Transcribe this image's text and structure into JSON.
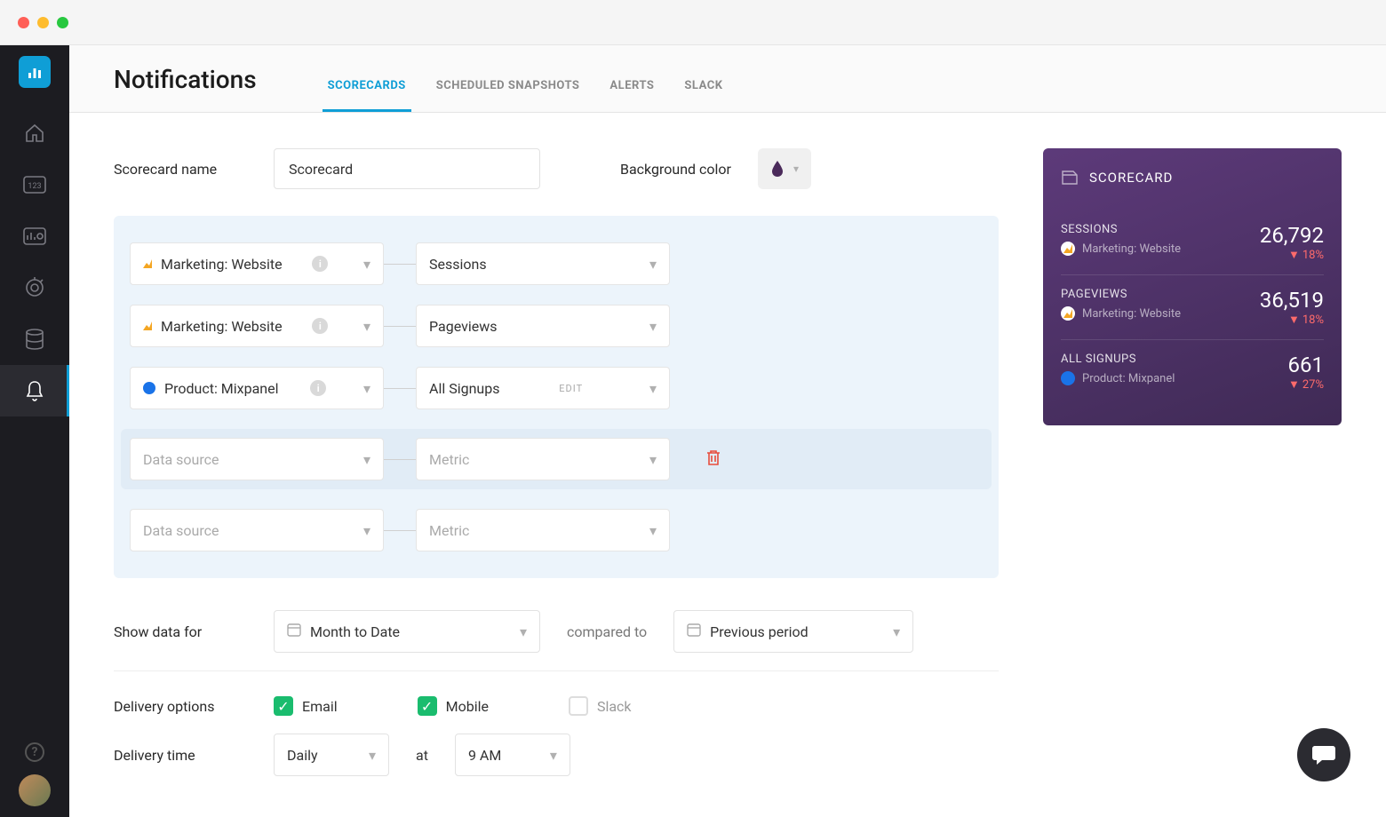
{
  "page": {
    "title": "Notifications"
  },
  "tabs": [
    "SCORECARDS",
    "SCHEDULED SNAPSHOTS",
    "ALERTS",
    "SLACK"
  ],
  "labels": {
    "scorecardName": "Scorecard name",
    "backgroundColor": "Background color",
    "showDataFor": "Show data for",
    "comparedTo": "compared to",
    "deliveryOptions": "Delivery options",
    "deliveryTime": "Delivery time",
    "at": "at"
  },
  "form": {
    "scorecardNameValue": "Scorecard",
    "dateRange": "Month to Date",
    "compareTo": "Previous period",
    "frequency": "Daily",
    "time": "9 AM"
  },
  "metrics": [
    {
      "source": "Marketing: Website",
      "sourceType": "ga",
      "metric": "Sessions",
      "edit": false
    },
    {
      "source": "Marketing: Website",
      "sourceType": "ga",
      "metric": "Pageviews",
      "edit": false
    },
    {
      "source": "Product: Mixpanel",
      "sourceType": "mx",
      "metric": "All Signups",
      "edit": true
    }
  ],
  "placeholders": {
    "dataSource": "Data source",
    "metric": "Metric",
    "edit": "EDIT"
  },
  "delivery": {
    "email": {
      "label": "Email",
      "checked": true
    },
    "mobile": {
      "label": "Mobile",
      "checked": true
    },
    "slack": {
      "label": "Slack",
      "checked": false
    }
  },
  "preview": {
    "title": "SCORECARD",
    "items": [
      {
        "name": "SESSIONS",
        "source": "Marketing: Website",
        "sourceType": "ga",
        "value": "26,792",
        "change": "18%"
      },
      {
        "name": "PAGEVIEWS",
        "source": "Marketing: Website",
        "sourceType": "ga",
        "value": "36,519",
        "change": "18%"
      },
      {
        "name": "ALL SIGNUPS",
        "source": "Product: Mixpanel",
        "sourceType": "mx",
        "value": "661",
        "change": "27%"
      }
    ]
  }
}
